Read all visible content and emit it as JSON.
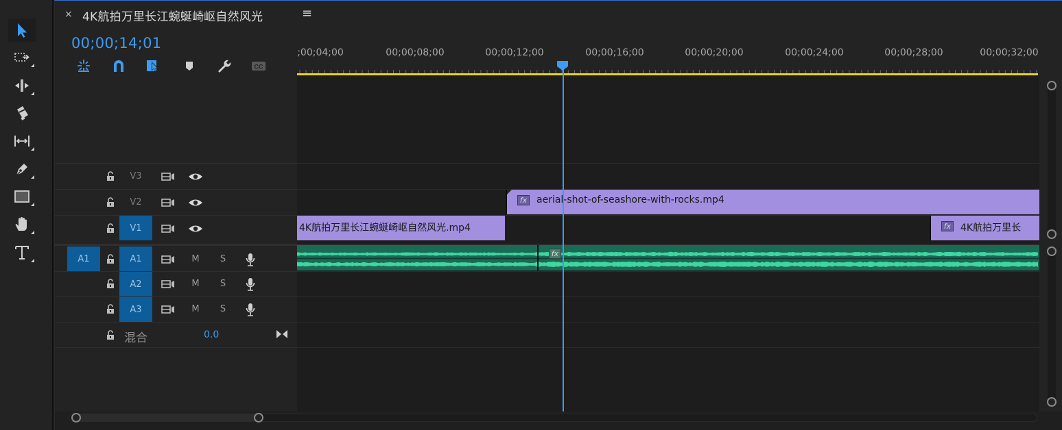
{
  "tab": {
    "close_glyph": "×",
    "title": "4K航拍万里长江蜿蜒崎岖自然风光",
    "menu_glyph": "≡"
  },
  "timecode": "00;00;14;01",
  "ruler": {
    "labels": [
      ";00;04;00",
      "00;00;08;00",
      "00;00;12;00",
      "00;00;16;00",
      "00;00;20;00",
      "00;00;24;00",
      "00;00;28;00",
      "00;00;32;00"
    ]
  },
  "playhead_timecode": "00;00;14;01",
  "tools": [
    "selection-tool",
    "track-select-forward-tool",
    "ripple-edit-tool",
    "razor-tool",
    "slip-tool",
    "pen-tool",
    "rectangle-tool",
    "hand-tool",
    "type-tool"
  ],
  "timeline_tools": [
    "nest-sequence-icon",
    "snap-icon",
    "linked-selection-icon",
    "add-marker-icon",
    "settings-wrench-icon",
    "captions-icon"
  ],
  "tracks": {
    "video": [
      {
        "name": "V3"
      },
      {
        "name": "V2"
      },
      {
        "name": "V1"
      }
    ],
    "audio": [
      {
        "name": "A1",
        "source": "A1",
        "mute": "M",
        "solo": "S"
      },
      {
        "name": "A2",
        "mute": "M",
        "solo": "S"
      },
      {
        "name": "A3",
        "mute": "M",
        "solo": "S"
      }
    ],
    "mix": {
      "label": "混合",
      "value": "0.0"
    }
  },
  "clips": {
    "v2_clip": {
      "name": "aerial-shot-of-seashore-with-rocks.mp4",
      "fx": "fx"
    },
    "v1_clip_a": {
      "name": "4K航拍万里长江蜿蜒崎岖自然风光.mp4"
    },
    "v1_clip_b": {
      "name": "4K航拍万里长",
      "fx": "fx"
    },
    "a1_clip": {
      "fx": "fx"
    }
  },
  "colors": {
    "accent_blue": "#3d9cf2",
    "video_clip": "#a28fe0",
    "audio_clip": "#1b6a55",
    "audio_wave": "#3fd6a0",
    "work_area": "#e8d21a",
    "track_target": "#0c5d9a"
  }
}
